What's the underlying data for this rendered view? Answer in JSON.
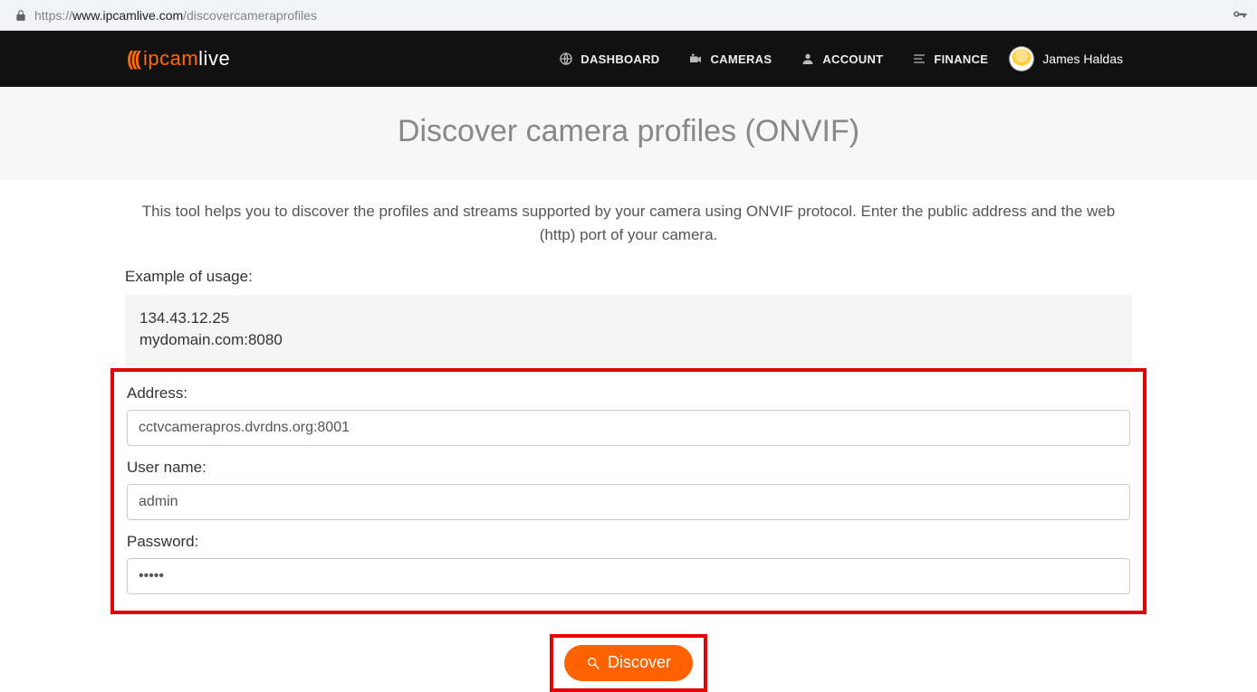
{
  "browser": {
    "url_scheme": "https://",
    "url_host": "www.ipcamlive.com",
    "url_path": "/discovercameraprofiles"
  },
  "navbar": {
    "brand_part1": "ipcam",
    "brand_part2": "live",
    "items": [
      {
        "label": "DASHBOARD"
      },
      {
        "label": "CAMERAS"
      },
      {
        "label": "ACCOUNT"
      },
      {
        "label": "FINANCE"
      }
    ],
    "user_name": "James Haldas"
  },
  "page": {
    "title": "Discover camera profiles (ONVIF)",
    "intro": "This tool helps you to discover the profiles and streams supported by your camera using ONVIF protocol. Enter the public address and the web (http) port of your camera.",
    "example_label": "Example of usage:",
    "example_line1": "134.43.12.25",
    "example_line2": "mydomain.com:8080"
  },
  "form": {
    "address_label": "Address:",
    "address_value": "cctvcamerapros.dvrdns.org:8001",
    "username_label": "User name:",
    "username_value": "admin",
    "password_label": "Password:",
    "password_value": "•••••",
    "discover_label": "Discover"
  }
}
